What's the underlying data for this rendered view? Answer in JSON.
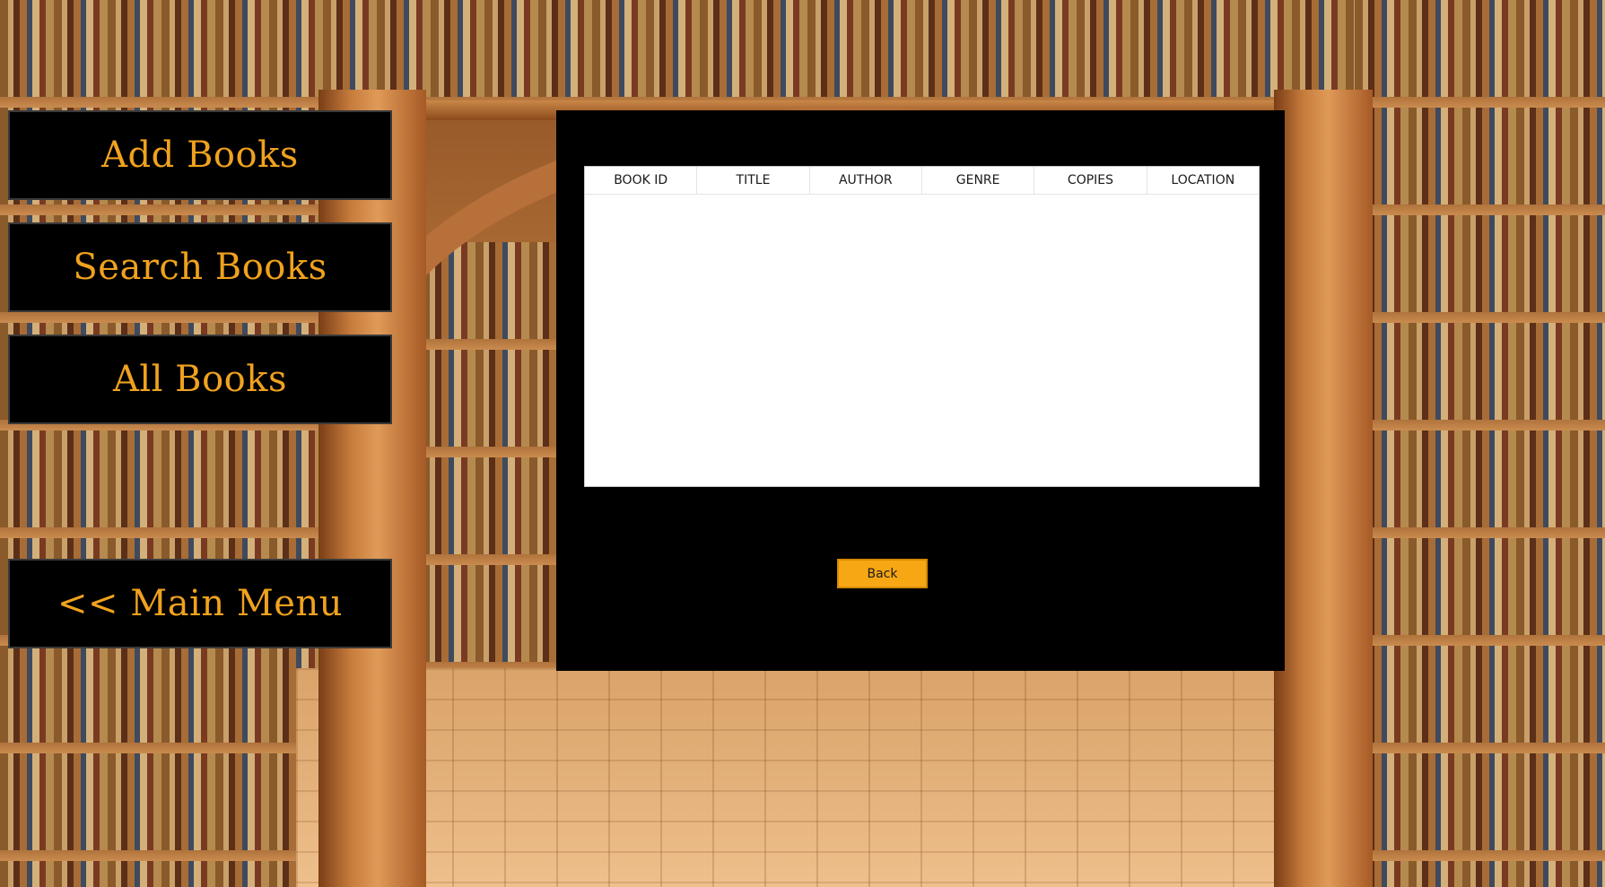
{
  "sidebar": {
    "items": [
      {
        "label": "Add Books"
      },
      {
        "label": "Search Books"
      },
      {
        "label": "All Books"
      },
      {
        "label": "<< Main Menu"
      }
    ]
  },
  "table": {
    "columns": [
      "BOOK ID",
      "TITLE",
      "AUTHOR",
      "GENRE",
      "COPIES",
      "LOCATION"
    ],
    "rows": []
  },
  "panel": {
    "back_label": "Back"
  },
  "colors": {
    "menu_text": "#f0a21e",
    "menu_bg": "#000000",
    "back_button": "#f7a713"
  }
}
